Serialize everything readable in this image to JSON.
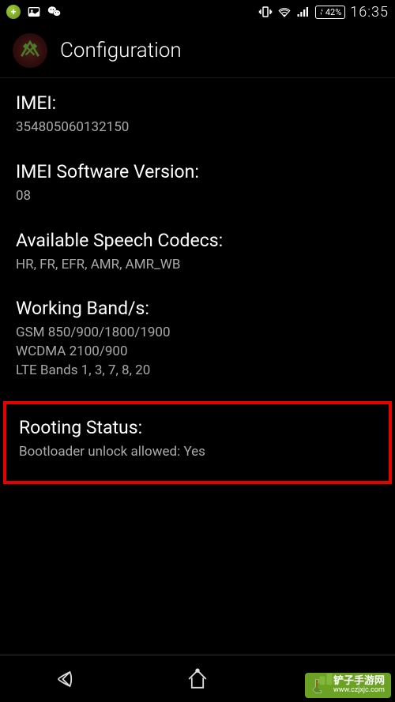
{
  "status_bar": {
    "battery": "42%",
    "time": "16:35"
  },
  "header": {
    "title": "Configuration"
  },
  "sections": {
    "imei": {
      "title": "IMEI:",
      "value": "354805060132150"
    },
    "imei_sw": {
      "title": "IMEI Software Version:",
      "value": "08"
    },
    "speech_codecs": {
      "title": "Available Speech Codecs:",
      "value": "HR, FR, EFR, AMR, AMR_WB"
    },
    "bands": {
      "title": "Working Band/s:",
      "line1": "GSM  850/900/1800/1900",
      "line2": "WCDMA  2100/900",
      "line3": "LTE Bands 1, 3, 7, 8, 20"
    },
    "rooting": {
      "title": "Rooting Status:",
      "value": "Bootloader unlock allowed: Yes"
    }
  },
  "watermark": {
    "main": "铲子手游网",
    "sub": "www.czjxjc.com"
  }
}
